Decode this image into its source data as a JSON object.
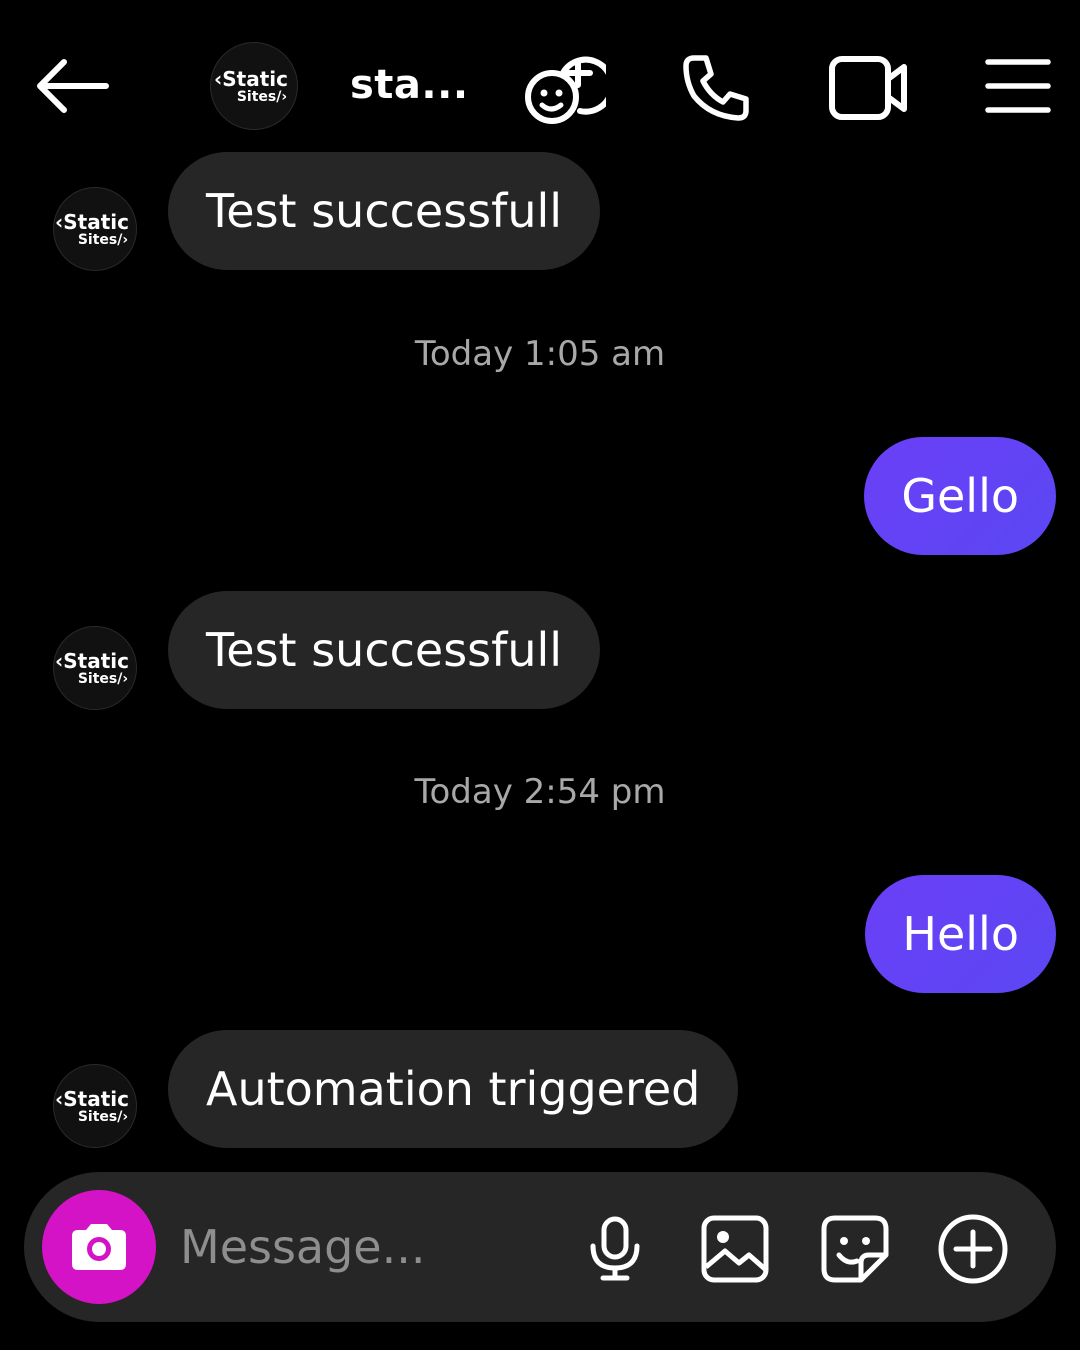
{
  "header": {
    "back_icon": "arrow-left-icon",
    "avatar": {
      "line1": "‹Static",
      "line2": "Sites/›"
    },
    "name": "sta...",
    "effects_icon": "add-effect-icon",
    "call_icon": "phone-icon",
    "video_icon": "video-camera-icon",
    "menu_icon": "menu-icon"
  },
  "avatar": {
    "line1": "‹Static",
    "line2": "Sites/›"
  },
  "messages": [
    {
      "direction": "incoming",
      "text": "Test successfull"
    },
    {
      "type": "timestamp",
      "text": "Today 1:05 am"
    },
    {
      "direction": "outgoing",
      "text": "Gello"
    },
    {
      "direction": "incoming",
      "text": "Test successfull"
    },
    {
      "type": "timestamp",
      "text": "Today 2:54 pm"
    },
    {
      "direction": "outgoing",
      "text": "Hello"
    },
    {
      "direction": "incoming",
      "text": "Automation triggered"
    }
  ],
  "composer": {
    "placeholder": "Message...",
    "camera_icon": "camera-icon",
    "mic_icon": "microphone-icon",
    "gallery_icon": "image-icon",
    "sticker_icon": "sticker-icon",
    "plus_icon": "plus-circle-icon"
  },
  "colors": {
    "background": "#000000",
    "incoming_bubble": "#262626",
    "outgoing_bubble": "#6a3ff7",
    "camera_button": "#d412c6",
    "timestamp": "#a8a8a8"
  }
}
